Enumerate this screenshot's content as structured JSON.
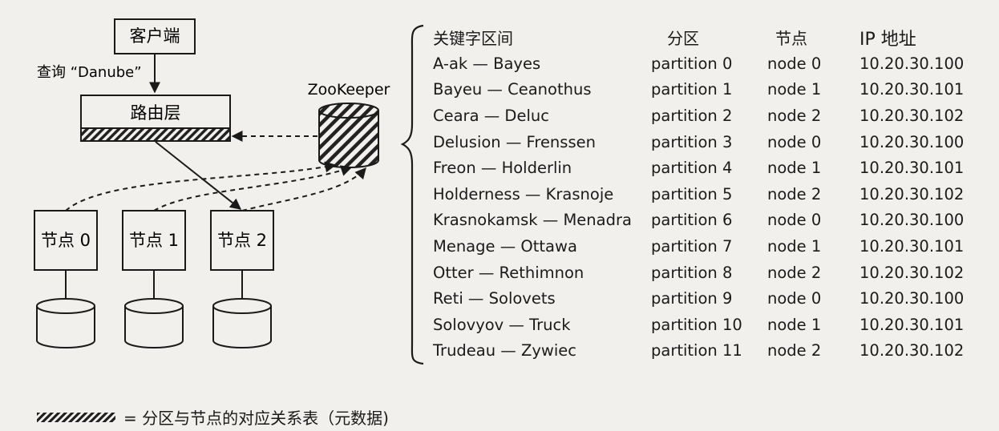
{
  "client": {
    "label": "客户端"
  },
  "query": {
    "label": "查询 “Danube”"
  },
  "routing": {
    "label": "路由层"
  },
  "zookeeper": {
    "label": "ZooKeeper"
  },
  "nodes": [
    {
      "label": "节点 0"
    },
    {
      "label": "节点 1"
    },
    {
      "label": "节点 2"
    }
  ],
  "table": {
    "headers": {
      "key_range": "关键字区间",
      "partition": "分区",
      "node": "节点",
      "ip": "IP 地址"
    },
    "rows": [
      {
        "range": "A-ak — Bayes",
        "partition": "partition 0",
        "node": "node 0",
        "ip": "10.20.30.100"
      },
      {
        "range": "Bayeu — Ceanothus",
        "partition": "partition 1",
        "node": "node 1",
        "ip": "10.20.30.101"
      },
      {
        "range": "Ceara — Deluc",
        "partition": "partition 2",
        "node": "node 2",
        "ip": "10.20.30.102"
      },
      {
        "range": "Delusion — Frenssen",
        "partition": "partition 3",
        "node": "node 0",
        "ip": "10.20.30.100"
      },
      {
        "range": "Freon — Holderlin",
        "partition": "partition 4",
        "node": "node 1",
        "ip": "10.20.30.101"
      },
      {
        "range": "Holderness — Krasnoje",
        "partition": "partition 5",
        "node": "node 2",
        "ip": "10.20.30.102"
      },
      {
        "range": "Krasnokamsk — Menadra",
        "partition": "partition 6",
        "node": "node 0",
        "ip": "10.20.30.100"
      },
      {
        "range": "Menage — Ottawa",
        "partition": "partition 7",
        "node": "node 1",
        "ip": "10.20.30.101"
      },
      {
        "range": "Otter — Rethimnon",
        "partition": "partition 8",
        "node": "node 2",
        "ip": "10.20.30.102"
      },
      {
        "range": "Reti — Solovets",
        "partition": "partition 9",
        "node": "node 0",
        "ip": "10.20.30.100"
      },
      {
        "range": "Solovyov — Truck",
        "partition": "partition 10",
        "node": "node 1",
        "ip": "10.20.30.101"
      },
      {
        "range": "Trudeau — Zywiec",
        "partition": "partition 11",
        "node": "node 2",
        "ip": "10.20.30.102"
      }
    ]
  },
  "legend": {
    "label": "= 分区与节点的对应关系表（元数据)"
  }
}
